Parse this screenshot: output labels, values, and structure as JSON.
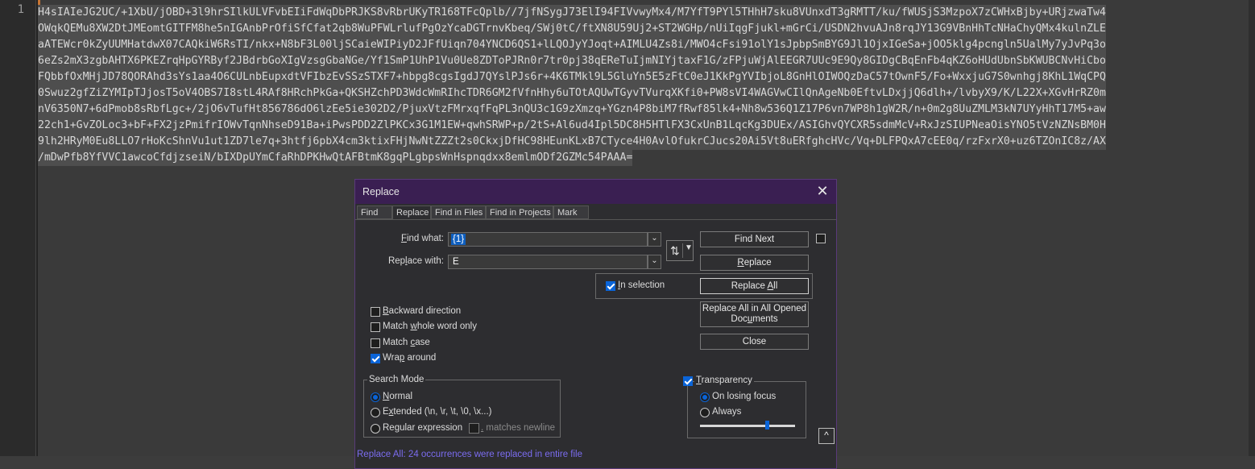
{
  "editor": {
    "line_number": "1",
    "lines": [
      "H4sIAIeJG2UC/+1XbU/jOBD+3l9hrSIlkULVFvbEIiFdWqDbPRJKS8vRbrUKyTR168TFcQplb//7jfNSygJ73ElI94FIVvwyMx4/M7YfT9PYl5THhH7sku8VUnxdT3gRMTT/ku/fWUSjS3MzpoX7zCWHxBjby+URjzwaTw4",
      "OWqkQEMu8XW2DtJMEomtGITFM8he5nIGAnbPrOfiSfCfat2qb8WuPFWLrlufPgOzYcaDGTrnvKbeq/SWj0tC/ftXN8U59Uj2+ST2WGHp/nUiIqgFjukl+mGrCi/USDN2hvuAJn8rqJY13G9VBnHhTcNHaChyQMx4kulnZLE",
      "aATEWcr0kZyUUMHatdwX07CAQkiW6RsTI/nkx+N8bF3L00ljSCaieWIPiyD2JFfUiqn704YNCD6QS1+lLQOJyYJoqt+AIMLU4Zs8i/MWO4cFsi91olY1sJpbpSmBYG9Jl1OjxIGeSa+jOO5klg4pcngln5UalMy7yJvPq3o",
      "6eZs2mX3zgbAHTX6PKEZrqHpGYRByf2JBdrbGoXIgVzsgGbaNGe/Yf1SmP1UhP1Vu0Ue8ZDToPJRn0r7tr0pj38qEReTuIjmNIYjtaxF1G/zFPjuWjAlEEGR7UUc9E9Qy8GIDgCBqEnFb4qKZ6oHUdUbnSbKWUBCNvHiCbo",
      "FQbbfOxMHjJD78QORAhd3sYs1aa4O6CULnbEupxdtVFIbzEvSSzSTXF7+hbpg8cgsIgdJ7QYslPJs6r+4K6TMkl9L5GluYn5E5zFtC0eJ1KkPgYVIbjoL8GnHlOIWOQzDaC57tOwnF5/Fo+WxxjuG7S0wnhgj8KhL1WqCPQ",
      "0Swuz2gfZiZYMIpTJjosT5oV4OBS7I8stL4RAf8HRchPkGa+QKSHZchPD3WdcWmRIhcTDR6GM2fVfnHhy6uTOtAQUwTGyvTVurqXKfi0+PW8sVI4WAGVwCIlQnAgeNb0EftvLDxjjQ6dlh+/lvbyX9/K/L22X+XGvHrRZ0m",
      "nV6350N7+6dPmob8sRbfLgc+/2jO6vTufHt856786dO6lzEe5ie302D2/PjuxVtzFMrxqfFqPL3nQU3c1G9zXmzq+YGzn4P8biM7fRwf85lk4+Nh8w536Q1Z17P6vn7WP8h1gW2R/n+0m2g8UuZMLM3kN7UYyHhT17M5+aw",
      "22ch1+GvZOLoc3+bF+FX2jzPmifrIOWvTqnNhseD91Ba+iPwsPDD2ZlPKCx3G1M1EW+qwhSRWP+p/2tS+Al6ud4Ipl5DC8H5HTlFX3CxUnB1LqcKg3DUEx/ASIGhvQYCXR5sdmMcV+RxJzSIUPNeaOisYNO5tVzNZNsBM0H",
      "9lh2HRyM0Eu8LLO7rHoKcShnVu1ut1ZD7le7q+3htfj6pbX4cm3ktixFHjNwNtZZZt2s0CkxjDfHC98HEunKLxB7CTyce4H0AvlOfukrCJucs20Ai5Vt8uERfghcHVc/Vq+DLFPQxA7cEE0q/rzFxrX0+uz6TZOnIC8z/AX",
      "/mDwPfb8YfVVC1awcoCfdjzseiN/bIXDpUYmCfaRhDPKHwQtAFBtmK8gqPLgbpsWnHspnqdxx8emlmODf2GZMc54PAAA="
    ]
  },
  "dialog": {
    "title": "Replace",
    "tabs": [
      {
        "label": "Find"
      },
      {
        "label": "Replace"
      },
      {
        "label": "Find in Files"
      },
      {
        "label": "Find in Projects"
      },
      {
        "label": "Mark"
      }
    ],
    "find_what_label_pre": "",
    "find_what_label_u": "F",
    "find_what_label_post": "ind what:",
    "find_what_value": "{1}",
    "replace_with_label_pre": "Rep",
    "replace_with_label_u": "l",
    "replace_with_label_post": "ace with:",
    "replace_with_value": "E",
    "buttons": {
      "find_next": "Find Next",
      "replace_pre": "",
      "replace_u": "R",
      "replace_post": "eplace",
      "replace_all_pre": "Replace ",
      "replace_all_u": "A",
      "replace_all_post": "ll",
      "replace_all_docs_line1": "Replace All in All Opened",
      "replace_all_docs_line2_pre": "Doc",
      "replace_all_docs_line2_u": "u",
      "replace_all_docs_line2_post": "ments",
      "close": "Close"
    },
    "in_selection_pre": "",
    "in_selection_u": "I",
    "in_selection_post": "n selection",
    "options": {
      "backward_pre": "",
      "backward_u": "B",
      "backward_post": "ackward direction",
      "whole_word_pre": "Match ",
      "whole_word_u": "w",
      "whole_word_post": "hole word only",
      "match_case_pre": "Match ",
      "match_case_u": "c",
      "match_case_post": "ase",
      "wrap_around_pre": "Wra",
      "wrap_around_u": "p",
      "wrap_around_post": " around"
    },
    "search_mode": {
      "title": "Search Mode",
      "normal_pre": "",
      "normal_u": "N",
      "normal_post": "ormal",
      "extended_pre": "E",
      "extended_u": "x",
      "extended_post": "tended (\\n, \\r, \\t, \\0, \\x...)",
      "regex_pre": "Re",
      "regex_u": "g",
      "regex_post": "ular expression",
      "matches_newline_u": ".",
      "matches_newline_post": " matches newline"
    },
    "transparency": {
      "title_pre": "",
      "title_u": "T",
      "title_post": "ransparency",
      "on_losing_focus": "On losing focus",
      "always": "Always",
      "level": 0.7
    },
    "collapse_icon_glyph": "^",
    "status": "Replace All: 24 occurrences were replaced in entire file"
  },
  "colors": {
    "accent": "#0a64d8",
    "titlebar": "#3a1f52",
    "status": "#7b6cf0",
    "caret_line": "#c87533"
  }
}
